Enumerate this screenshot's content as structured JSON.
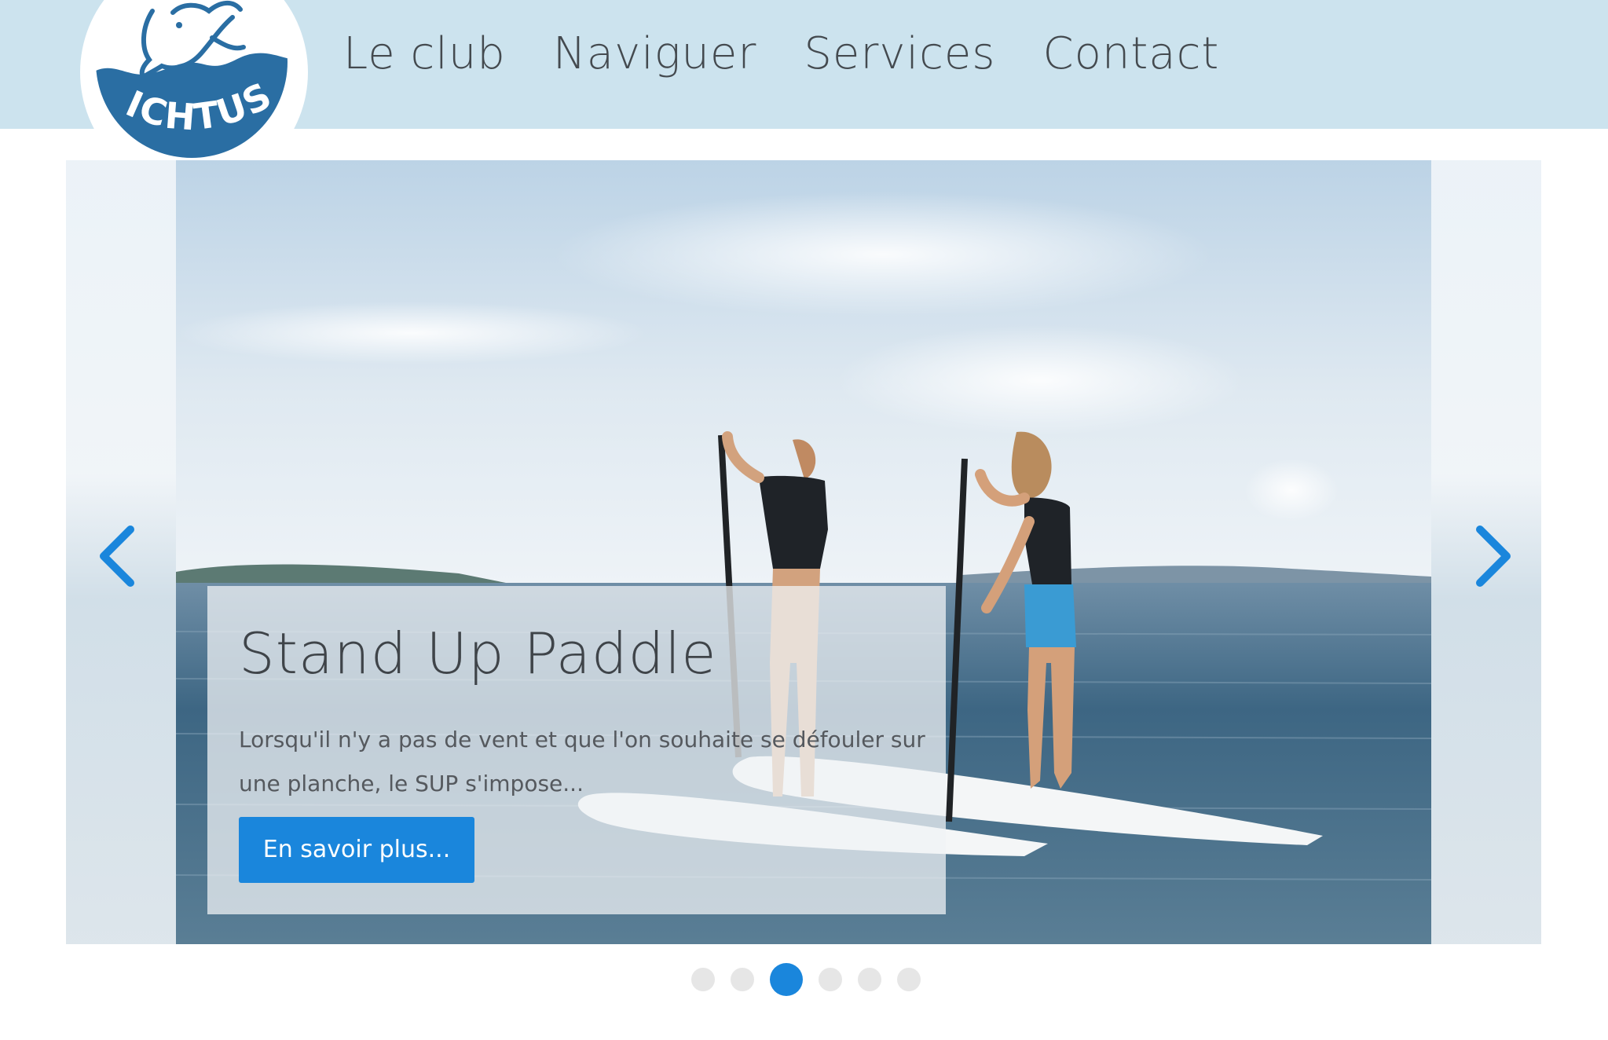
{
  "brand": {
    "logo_text": "ICHTUS",
    "logo_color": "#2a6ea3"
  },
  "nav": {
    "items": [
      {
        "label": "Le club"
      },
      {
        "label": "Naviguer"
      },
      {
        "label": "Services"
      },
      {
        "label": "Contact"
      }
    ]
  },
  "carousel": {
    "slide": {
      "image": "stand-up-paddle-photo",
      "title": "Stand Up Paddle",
      "text": "Lorsqu'il n'y a pas de vent et que l'on souhaite se défouler sur une planche, le SUP s'impose...",
      "button_label": "En savoir plus..."
    },
    "prev_icon": "chevron-left-icon",
    "next_icon": "chevron-right-icon",
    "slide_count": 6,
    "active_index": 2
  },
  "colors": {
    "header_bg": "#cce3ee",
    "accent": "#1a86dc",
    "nav_text": "#444a4f",
    "dot_inactive": "#e6e6e6"
  }
}
